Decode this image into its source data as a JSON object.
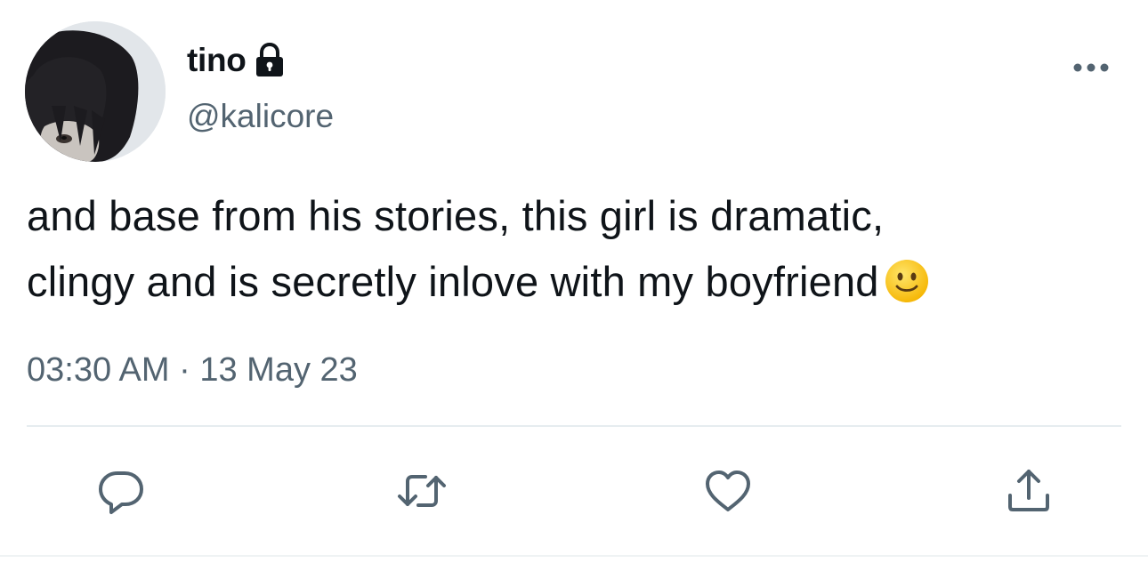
{
  "tweet": {
    "author": {
      "display_name": "tino",
      "handle": "@kalicore",
      "protected_icon": "lock-icon",
      "avatar": "avatar-photo"
    },
    "text_lines": [
      "and base from his stories, this girl is dramatic,",
      "clingy and is secretly inlove with my boyfriend"
    ],
    "emoji": "slightly-smiling-face-emoji",
    "time": "03:30 AM",
    "separator": "·",
    "date": "13 May 23"
  },
  "actions": [
    {
      "icon": "reply-icon"
    },
    {
      "icon": "retweet-icon"
    },
    {
      "icon": "like-icon"
    },
    {
      "icon": "share-icon"
    }
  ],
  "menu_icon": "more-options-icon",
  "colors": {
    "text_primary": "#0f1419",
    "text_secondary": "#536471",
    "divider": "#e6ecf0",
    "icon": "#536471"
  }
}
